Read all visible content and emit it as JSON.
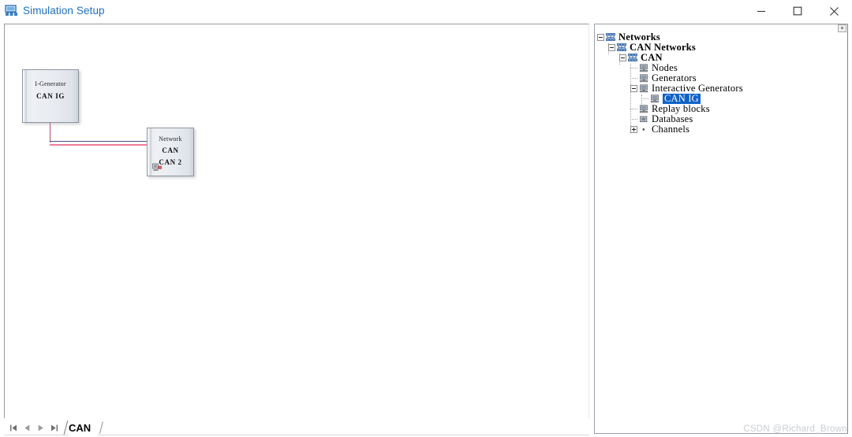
{
  "window": {
    "title": "Simulation Setup",
    "icon": "simulation-setup-icon",
    "controls": {
      "minimize": "—",
      "maximize": "□",
      "close": "✕"
    }
  },
  "canvas": {
    "blocks": [
      {
        "name": "interactive-generator-block",
        "line1": "I-Generator",
        "line2": "CAN IG",
        "line3": "",
        "badge": ""
      },
      {
        "name": "network-block",
        "line1": "Network",
        "line2": "CAN",
        "line3": "CAN 2",
        "badge": "bus-terminator-icon"
      }
    ],
    "wire_colors": {
      "can_high": "#4a5080",
      "can_low": "#ef7d97",
      "drop": "#c24a6a"
    }
  },
  "tabstrip": {
    "nav": [
      {
        "name": "first-page-button",
        "glyph": "first"
      },
      {
        "name": "previous-page-button",
        "glyph": "prev"
      },
      {
        "name": "next-page-button",
        "glyph": "next"
      },
      {
        "name": "last-page-button",
        "glyph": "last"
      }
    ],
    "tabs": [
      {
        "label": "CAN",
        "active": true
      }
    ]
  },
  "tree": {
    "close_glyph": "×",
    "selection_color": "#0f62c8",
    "nodes": [
      {
        "label": "Networks",
        "indent": 0,
        "expander": "minus",
        "icon": "network-icon",
        "bold": true,
        "selected": false
      },
      {
        "label": "CAN Networks",
        "indent": 1,
        "expander": "minus",
        "icon": "network-icon",
        "bold": true,
        "selected": false
      },
      {
        "label": "CAN",
        "indent": 2,
        "expander": "minus",
        "icon": "network-icon",
        "bold": true,
        "selected": false
      },
      {
        "label": "Nodes",
        "indent": 3,
        "expander": "stub",
        "icon": "node-icon",
        "bold": false,
        "selected": false
      },
      {
        "label": "Generators",
        "indent": 3,
        "expander": "stub",
        "icon": "node-icon",
        "bold": false,
        "selected": false
      },
      {
        "label": "Interactive Generators",
        "indent": 3,
        "expander": "minus",
        "icon": "node-icon",
        "bold": false,
        "selected": false
      },
      {
        "label": "CAN IG",
        "indent": 4,
        "expander": "stub",
        "icon": "node-icon",
        "bold": false,
        "selected": true
      },
      {
        "label": "Replay blocks",
        "indent": 3,
        "expander": "stub",
        "icon": "node-icon",
        "bold": false,
        "selected": false
      },
      {
        "label": "Databases",
        "indent": 3,
        "expander": "stub",
        "icon": "database-icon",
        "bold": false,
        "selected": false
      },
      {
        "label": "Channels",
        "indent": 3,
        "expander": "plus",
        "icon": "channel-icon",
        "bold": false,
        "selected": false
      }
    ]
  },
  "watermark": {
    "text": "CSDN @Richard_Brown"
  }
}
